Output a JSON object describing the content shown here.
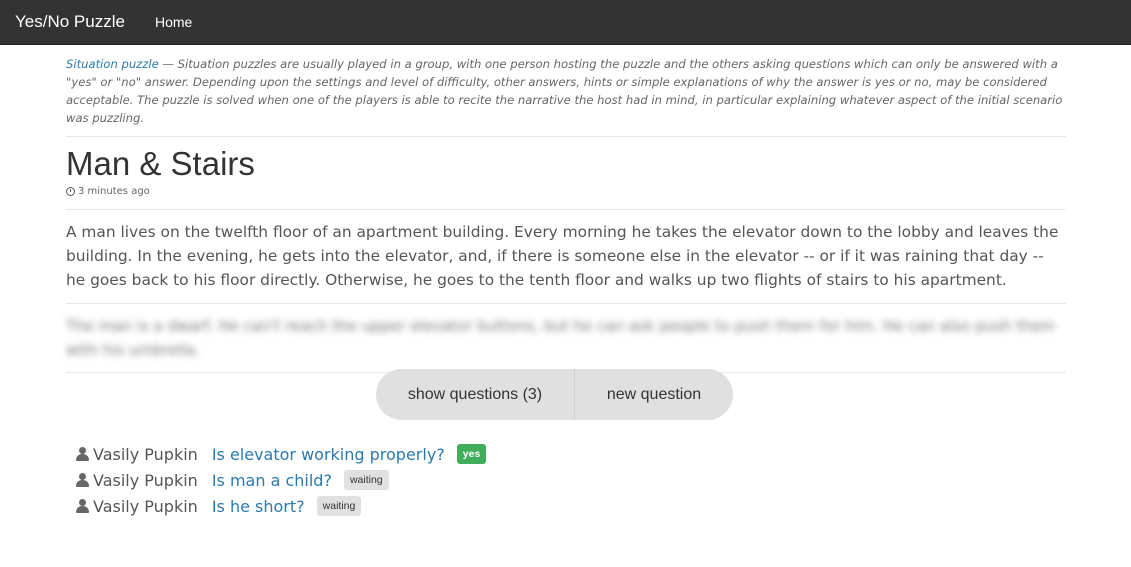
{
  "navbar": {
    "brand": "Yes/No Puzzle",
    "home": "Home"
  },
  "intro": {
    "link": "Situation puzzle",
    "text": " — Situation puzzles are usually played in a group, with one person hosting the puzzle and the others asking questions which can only be answered with a \"yes\" or \"no\" answer. Depending upon the settings and level of difficulty, other answers, hints or simple explanations of why the answer is yes or no, may be considered acceptable. The puzzle is solved when one of the players is able to recite the narrative the host had in mind, in particular explaining whatever aspect of the initial scenario was puzzling."
  },
  "puzzle": {
    "title": "Man & Stairs",
    "time": "3 minutes ago",
    "story": "A man lives on the twelfth floor of an apartment building. Every morning he takes the elevator down to the lobby and leaves the building. In the evening, he gets into the elevator, and, if there is someone else in the elevator -- or if it was raining that day -- he goes back to his floor directly. Otherwise, he goes to the tenth floor and walks up two flights of stairs to his apartment.",
    "answer": "The man is a dwarf. He can't reach the upper elevator buttons, but he can ask people to push them for him. He can also push them with his umbrella."
  },
  "buttons": {
    "show_questions": "show questions (3)",
    "new_question": "new question"
  },
  "questions": [
    {
      "user": "Vasily Pupkin",
      "text": "Is elevator working properly?",
      "status": "yes"
    },
    {
      "user": "Vasily Pupkin",
      "text": "Is man a child?",
      "status": "waiting"
    },
    {
      "user": "Vasily Pupkin",
      "text": "Is he short?",
      "status": "waiting"
    }
  ],
  "colors": {
    "navbar": "#333333",
    "link": "#2a7ab0",
    "badge_yes": "#3fad5a",
    "badge_waiting": "#e0e0e0"
  },
  "icons": {
    "time": "clock-icon",
    "user": "user-icon"
  }
}
